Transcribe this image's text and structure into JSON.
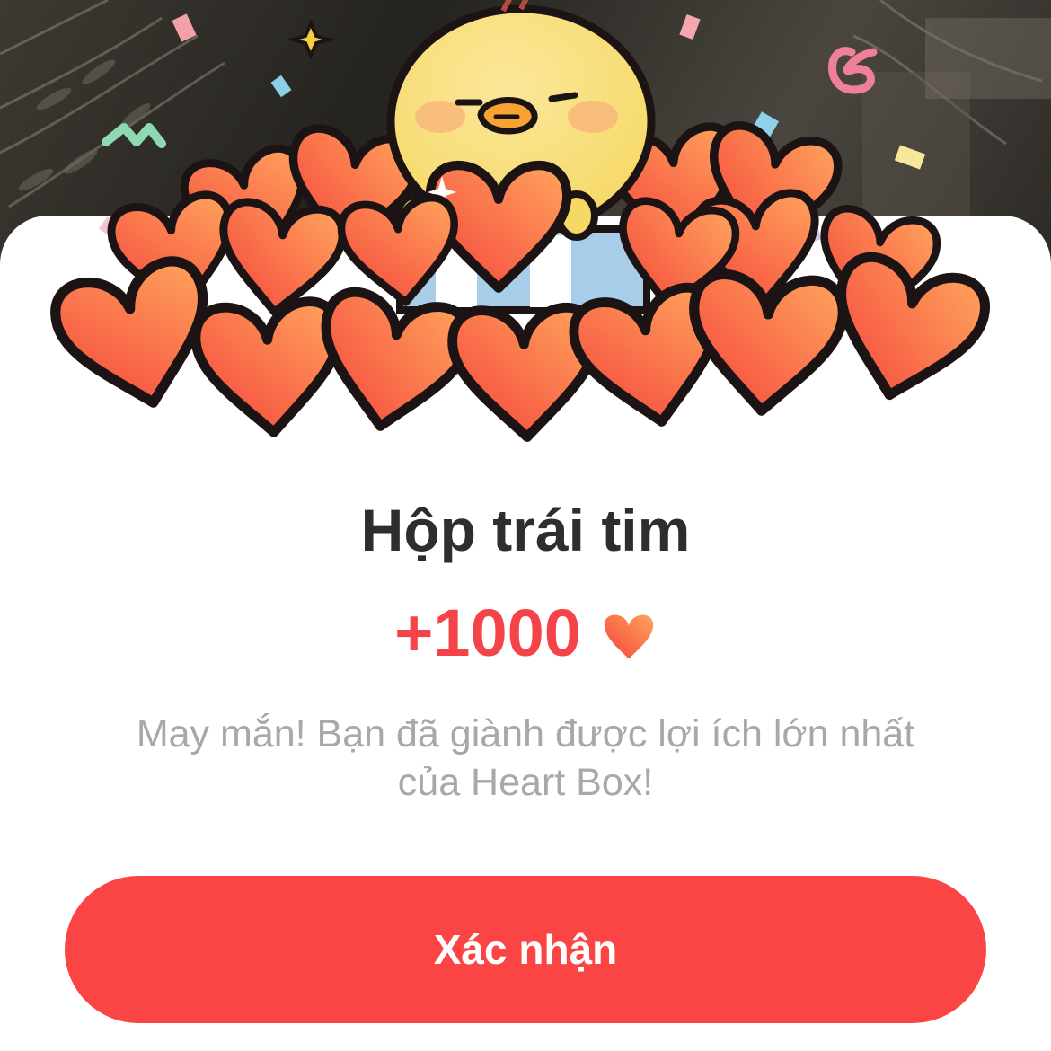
{
  "dialog": {
    "title": "Hộp trái tim",
    "reward_amount": "+1000",
    "reward_icon": "heart-icon",
    "message_line1": "May mắn! Bạn đã giành được lợi ích lớn nhất",
    "message_line2": "của Heart Box!",
    "confirm_label": "Xác nhận"
  },
  "colors": {
    "accent": "#fb4444",
    "reward_text": "#f44349",
    "title_text": "#2e2e2e",
    "message_text": "#a8a8a8",
    "heart_light": "#ffa45c",
    "heart_dark": "#f4443c"
  }
}
